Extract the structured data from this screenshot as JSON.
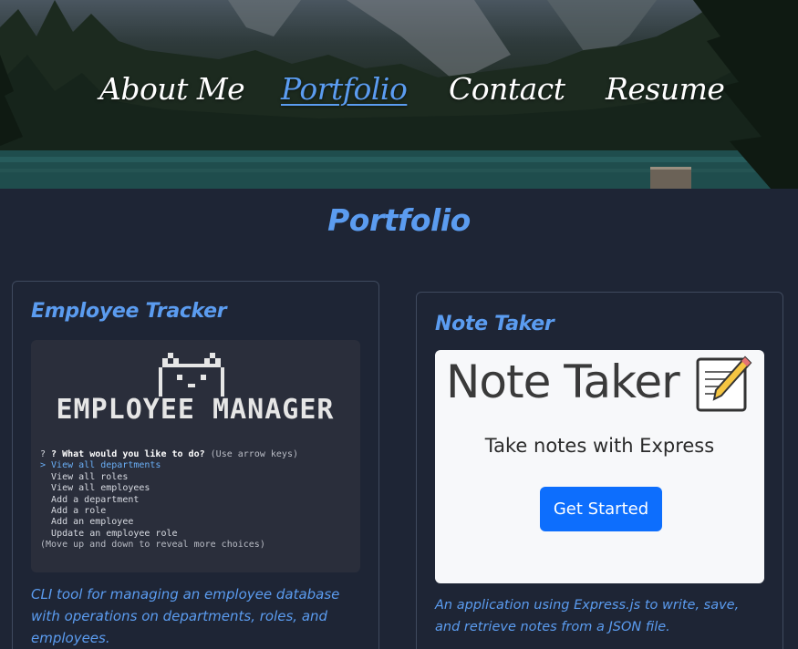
{
  "nav": {
    "items": [
      {
        "label": "About Me",
        "active": false
      },
      {
        "label": "Portfolio",
        "active": true
      },
      {
        "label": "Contact",
        "active": false
      },
      {
        "label": "Resume",
        "active": false
      }
    ]
  },
  "section": {
    "title": "Portfolio"
  },
  "projects": [
    {
      "title": "Employee Tracker",
      "description": "CLI tool for managing an employee database with operations on departments, roles, and employees.",
      "screenshot": {
        "banner_text": "EMPLOYEE MANAGER",
        "prompt": "? What would you like to do?",
        "prompt_hint": "(Use arrow keys)",
        "selected": "> View all departments",
        "choices": [
          "View all roles",
          "View all employees",
          "Add a department",
          "Add a role",
          "Add an employee",
          "Update an employee role"
        ],
        "footer": "(Move up and down to reveal more choices)"
      }
    },
    {
      "title": "Note Taker",
      "description": "An application using Express.js to write, save, and retrieve notes from a JSON file.",
      "screenshot": {
        "heading": "Note Taker",
        "subheading": "Take notes with Express",
        "button": "Get Started"
      }
    }
  ],
  "colors": {
    "accent": "#5b9cf0",
    "background": "#1e2535",
    "card_border": "#3f4a5e",
    "button": "#0d6efd"
  },
  "icons": {
    "note_icon": "memo-pencil-icon",
    "cat_icon": "pixel-cat-icon"
  }
}
